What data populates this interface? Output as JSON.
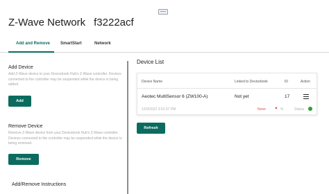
{
  "window": {
    "widget_icon": "window-restore-icon"
  },
  "header": {
    "title": "Z-Wave Network",
    "hub_id": "f3222acf"
  },
  "tabs": [
    {
      "label": "Add and Remove",
      "active": true
    },
    {
      "label": "SmartStart",
      "active": false
    },
    {
      "label": "Network",
      "active": false
    }
  ],
  "add_device": {
    "title": "Add Device",
    "description": "Add Z-Wave device to your Devicebook Hub's Z-Wave controller. Devices connected to the controller may be suspended while the device is being added.",
    "button": "Add"
  },
  "remove_device": {
    "title": "Remove Device",
    "description": "Remove Z-Wave device from your Devicebook Hub's Z-Wave controller. Devices connected to the controller may be suspended while the device is being removed.",
    "button": "Remove"
  },
  "instructions": {
    "title": "Add/Remove Instructions"
  },
  "device_list": {
    "title": "Device List",
    "columns": [
      "Device Name",
      "Linked to Devicebook",
      "ID",
      "Action"
    ],
    "rows": [
      {
        "name": "Aeotec MultiSensor 6 (ZW100-A)",
        "linked": "Not yet",
        "id": "17",
        "action_icon": "menu-icon",
        "timestamp": "12/9/2022 3:53:37 PM",
        "security": "None",
        "health_icon": "heart-icon",
        "health": "%",
        "status_label": "Status",
        "status_color": "#2e9e3a"
      }
    ],
    "refresh_button": "Refresh"
  },
  "colors": {
    "accent": "#0b6b5e",
    "error": "#d9534f",
    "ok": "#2e9e3a"
  }
}
